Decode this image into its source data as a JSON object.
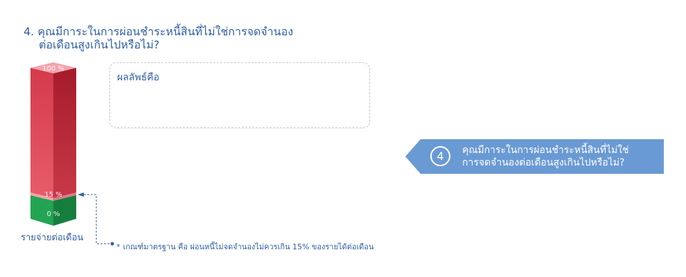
{
  "question": {
    "line1": "4. คุณมีการะในการผ่อนชำระหนี้สินที่ไม่ใช่การจดจำนอง",
    "line2": "ต่อเดือนสูงเกินไปหรือไม่?"
  },
  "gauge": {
    "tick_top": "100 %",
    "tick_mid": "15 %",
    "tick_bottom": "0 %",
    "label": "รายจ่ายต่อเดือน",
    "threshold_percent": 15,
    "colors": {
      "danger": "#e0414f",
      "safe": "#1e9a4c"
    }
  },
  "answer": {
    "label": "ผลลัพธ์คือ"
  },
  "footnote": {
    "star": "*",
    "text": "เกณฑ์มาตรฐาน คือ ผ่อนหนี้ไม่จดจำนองไม่ควรเกิน 15% ของรายได้ต่อเดือน"
  },
  "banner": {
    "number": "4",
    "line1": "คุณมีการะในการผ่อนชำระหนี้สินที่ไม่ใช่",
    "line2": "การจดจำนองต่อเดือนสูงเกินไปหรือไม่?",
    "color": "#6a9ad4"
  }
}
